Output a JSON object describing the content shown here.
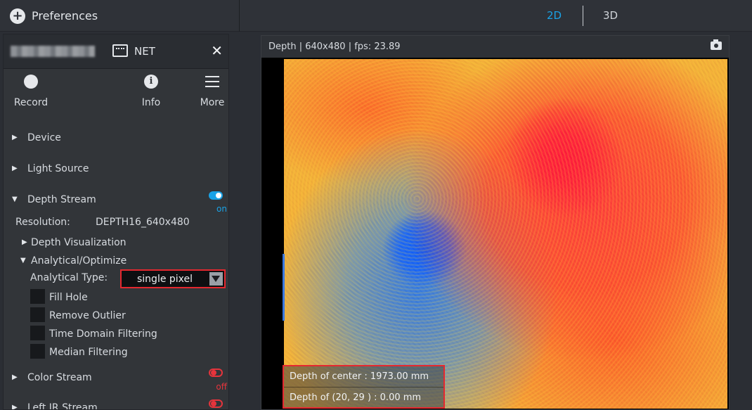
{
  "topbar": {
    "preferences_label": "Preferences",
    "tab_2d": "2D",
    "tab_3d": "3D"
  },
  "device_header": {
    "connection_label": "NET",
    "close_symbol": "✕"
  },
  "actions": [
    {
      "label": "Record",
      "icon": "record-icon"
    },
    {
      "label": "Info",
      "icon": "info-icon",
      "symbol": "i"
    },
    {
      "label": "More",
      "icon": "menu-icon"
    }
  ],
  "sections": {
    "device": "Device",
    "light_source": "Light Source",
    "depth_stream": {
      "label": "Depth Stream",
      "state": "on"
    },
    "color_stream": {
      "label": "Color Stream",
      "state": "off"
    },
    "left_ir_stream": {
      "label": "Left IR Stream"
    }
  },
  "depth": {
    "resolution_label": "Resolution:",
    "resolution_value": "DEPTH16_640x480",
    "visualization_label": "Depth Visualization",
    "analytical_label": "Analytical/Optimize",
    "analytical_type_label": "Analytical Type:",
    "analytical_type_value": "single pixel",
    "checkboxes": [
      "Fill Hole",
      "Remove Outlier",
      "Time Domain Filtering",
      "Median Filtering"
    ]
  },
  "stream": {
    "title": "Depth | 640x480 | fps: 23.89",
    "center_depth": "Depth of center : 1973.00   mm",
    "pixel_depth": "Depth of (20, 29 ) : 0.00   mm"
  },
  "colors": {
    "accent": "#1aa2e6",
    "alert": "#e5282f"
  }
}
